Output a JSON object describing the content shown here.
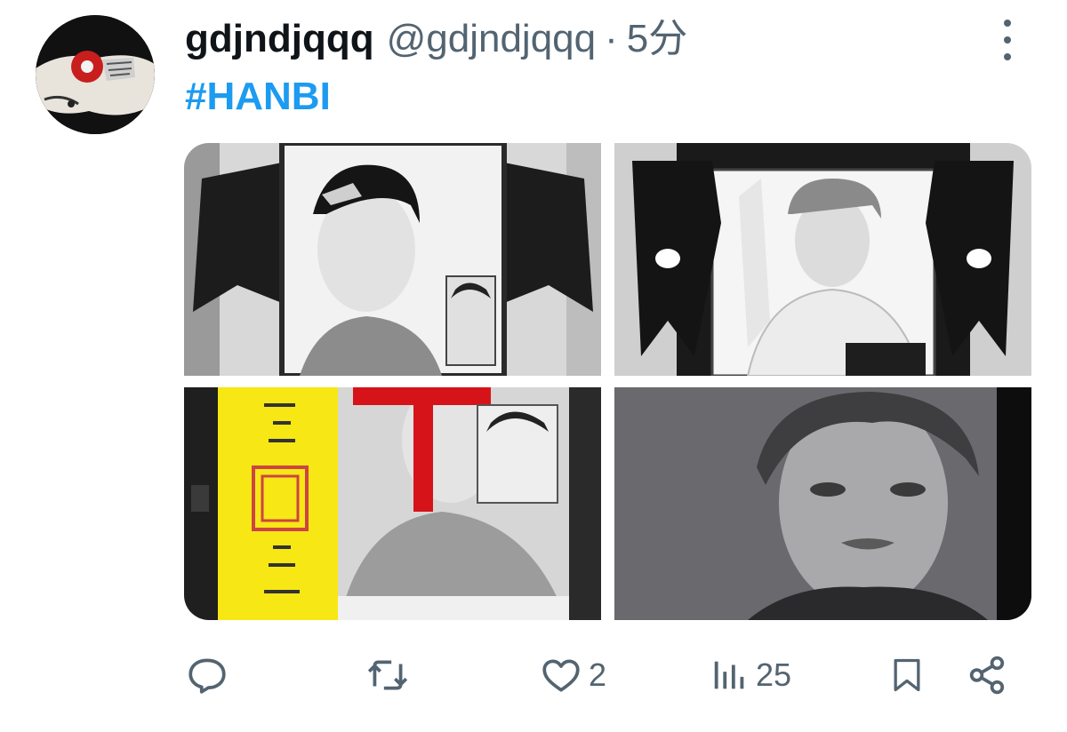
{
  "tweet": {
    "display_name": "gdjndjqqq",
    "handle": "@gdjndjqqq",
    "separator": "·",
    "time": "5分",
    "hashtag": "#HANBI",
    "media": [
      {
        "icon": "photo-memorial-portrait-ribbons"
      },
      {
        "icon": "photo-portrait-black-frame"
      },
      {
        "icon": "photo-talisman-and-poster"
      },
      {
        "icon": "photo-grayscale-closeup"
      }
    ]
  },
  "actions": {
    "reply": {
      "icon": "reply-icon",
      "count": ""
    },
    "retweet": {
      "icon": "retweet-icon",
      "count": ""
    },
    "like": {
      "icon": "heart-icon",
      "count": "2"
    },
    "views": {
      "icon": "views-icon",
      "count": "25"
    },
    "bookmark": {
      "icon": "bookmark-icon"
    },
    "share": {
      "icon": "share-icon"
    }
  },
  "colors": {
    "text": "#0f1419",
    "secondary": "#536471",
    "link": "#1d9bf0"
  }
}
